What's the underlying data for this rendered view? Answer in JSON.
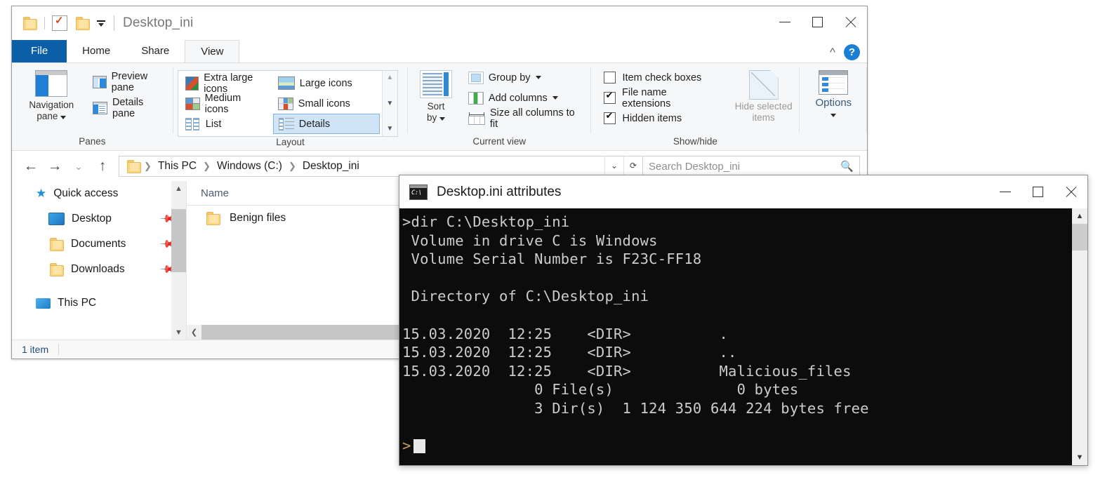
{
  "explorer": {
    "title": "Desktop_ini",
    "quick_access_toolbar": {
      "folder_icon": "folder-icon",
      "properties_icon": "checkbox-properties-icon",
      "new_folder_icon": "new-folder-icon",
      "customize_label": "customize-quick-access-toolbar"
    },
    "window_controls": {
      "minimize": "minimize-icon",
      "maximize": "maximize-icon",
      "close": "close-icon"
    },
    "tabs": [
      {
        "label": "File",
        "active": false
      },
      {
        "label": "Home",
        "active": false
      },
      {
        "label": "Share",
        "active": false
      },
      {
        "label": "View",
        "active": true
      }
    ],
    "ribbon_collapse_icon": "chevron-up-icon",
    "help_label": "?",
    "ribbon": {
      "groups": [
        {
          "label": "Panes",
          "big_button": {
            "label": "Navigation\npane",
            "line1": "Navigation",
            "line2": "pane",
            "icon": "navigation-pane-icon"
          },
          "small_buttons": [
            {
              "label": "Preview pane",
              "icon": "preview-pane-icon"
            },
            {
              "label": "Details pane",
              "icon": "details-pane-icon"
            }
          ]
        },
        {
          "label": "Layout",
          "items": [
            {
              "label": "Extra large icons",
              "icon": "extra-large-icons-icon",
              "selected": false
            },
            {
              "label": "Large icons",
              "icon": "large-icons-icon",
              "selected": false
            },
            {
              "label": "Medium icons",
              "icon": "medium-icons-icon",
              "selected": false
            },
            {
              "label": "Small icons",
              "icon": "small-icons-icon",
              "selected": false
            },
            {
              "label": "List",
              "icon": "list-view-icon",
              "selected": false
            },
            {
              "label": "Details",
              "icon": "details-view-icon",
              "selected": true
            }
          ]
        },
        {
          "label": "Current view",
          "big_button": {
            "line1": "Sort",
            "line2": "by",
            "icon": "sort-by-icon"
          },
          "small_buttons": [
            {
              "label": "Group by",
              "icon": "group-by-icon",
              "dropdown": true
            },
            {
              "label": "Add columns",
              "icon": "add-columns-icon",
              "dropdown": true
            },
            {
              "label": "Size all columns to fit",
              "icon": "size-columns-icon",
              "dropdown": false
            }
          ]
        },
        {
          "label": "Show/hide",
          "checkboxes": [
            {
              "label": "Item check boxes",
              "checked": false
            },
            {
              "label": "File name extensions",
              "checked": true
            },
            {
              "label": "Hidden items",
              "checked": true
            }
          ],
          "big_button": {
            "line1": "Hide selected",
            "line2": "items",
            "icon": "hide-selected-items-icon",
            "disabled": true
          }
        },
        {
          "label": "",
          "big_button": {
            "line1": "Options",
            "line2": "",
            "icon": "options-icon"
          }
        }
      ]
    },
    "address_bar": {
      "back_icon": "back-arrow-icon",
      "forward_icon": "forward-arrow-icon",
      "recent_icon": "chevron-down-icon",
      "up_icon": "up-arrow-icon",
      "breadcrumb_folder_icon": "folder-icon",
      "breadcrumbs": [
        "This PC",
        "Windows (C:)",
        "Desktop_ini"
      ],
      "separator": "❯",
      "refresh_icon": "refresh-icon",
      "search_placeholder": "Search Desktop_ini",
      "search_icon": "search-icon"
    },
    "navigation_pane": {
      "items": [
        {
          "label": "Quick access",
          "icon": "quick-access-star-icon",
          "level": 0,
          "pinned": false
        },
        {
          "label": "Desktop",
          "icon": "desktop-icon",
          "level": 1,
          "pinned": true
        },
        {
          "label": "Documents",
          "icon": "folder-icon",
          "level": 1,
          "pinned": true
        },
        {
          "label": "Downloads",
          "icon": "folder-icon",
          "level": 1,
          "pinned": true
        },
        {
          "label": "This PC",
          "icon": "this-pc-icon",
          "level": 0,
          "pinned": false
        }
      ]
    },
    "file_list": {
      "columns": [
        "Name"
      ],
      "sort_indicator": "ascending",
      "rows": [
        {
          "name": "Benign files",
          "icon": "folder-icon"
        }
      ]
    },
    "status_bar": {
      "item_count": "1 item"
    }
  },
  "console": {
    "title": "Desktop.ini attributes",
    "icon_text": "C:\\",
    "window_controls": {
      "minimize": "minimize-icon",
      "maximize": "maximize-icon",
      "close": "close-icon"
    },
    "prompt_symbol": ">",
    "lines": [
      ">dir C:\\Desktop_ini",
      " Volume in drive C is Windows",
      " Volume Serial Number is F23C-FF18",
      "",
      " Directory of C:\\Desktop_ini",
      "",
      "15.03.2020  12:25    <DIR>          .",
      "15.03.2020  12:25    <DIR>          ..",
      "15.03.2020  12:25    <DIR>          Malicious_files",
      "               0 File(s)              0 bytes",
      "               3 Dir(s)  1 124 350 644 224 bytes free",
      ""
    ],
    "cursor_line": ">"
  },
  "colors": {
    "accent_blue": "#0b5ea8",
    "ribbon_bg": "#f6f7f8",
    "console_bg": "#0c0c0c",
    "console_fg": "#cccccc",
    "prompt_color": "#c8a05a",
    "selection_blue": "#cfe4f7"
  }
}
